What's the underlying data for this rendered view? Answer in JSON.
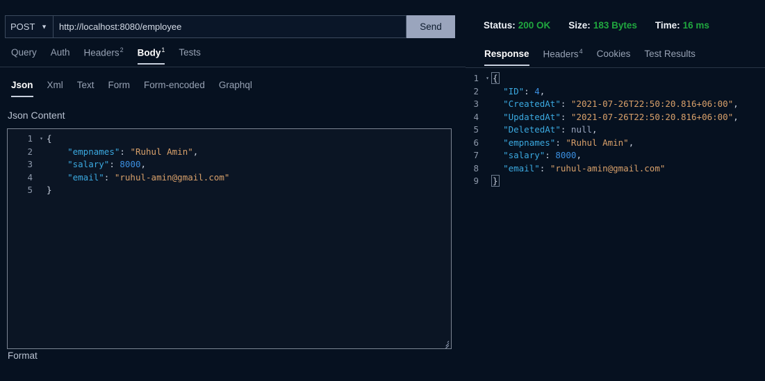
{
  "request": {
    "method": "POST",
    "method_caret_icon": "chevron-down-icon",
    "url": "http://localhost:8080/employee",
    "url_placeholder": "http://localhost:8080/employee",
    "send_label": "Send",
    "tabs": [
      {
        "label": "Query",
        "badge": "",
        "active": false
      },
      {
        "label": "Auth",
        "badge": "",
        "active": false
      },
      {
        "label": "Headers",
        "badge": "2",
        "active": false
      },
      {
        "label": "Body",
        "badge": "1",
        "active": true
      },
      {
        "label": "Tests",
        "badge": "",
        "active": false
      }
    ],
    "body_tabs": [
      {
        "label": "Json",
        "badge": "",
        "active": true
      },
      {
        "label": "Xml",
        "badge": "",
        "active": false
      },
      {
        "label": "Text",
        "badge": "",
        "active": false
      },
      {
        "label": "Form",
        "badge": "",
        "active": false
      },
      {
        "label": "Form-encoded",
        "badge": "",
        "active": false
      },
      {
        "label": "Graphql",
        "badge": "",
        "active": false
      }
    ],
    "content_label": "Json Content",
    "format_label": "Format",
    "editor_lines": [
      {
        "n": "1",
        "fold": "▾",
        "text": "{"
      },
      {
        "n": "2",
        "fold": "",
        "text": "    \"empnames\": \"Ruhul Amin\","
      },
      {
        "n": "3",
        "fold": "",
        "text": "    \"salary\": 8000,"
      },
      {
        "n": "4",
        "fold": "",
        "text": "    \"email\": \"ruhul-amin@gmail.com\""
      },
      {
        "n": "5",
        "fold": "",
        "text": "}"
      }
    ]
  },
  "response": {
    "status": {
      "label": "Status:",
      "value": "200 OK"
    },
    "size": {
      "label": "Size:",
      "value": "183 Bytes"
    },
    "time": {
      "label": "Time:",
      "value": "16 ms"
    },
    "tabs": [
      {
        "label": "Response",
        "badge": "",
        "active": true
      },
      {
        "label": "Headers",
        "badge": "4",
        "active": false
      },
      {
        "label": "Cookies",
        "badge": "",
        "active": false
      },
      {
        "label": "Test Results",
        "badge": "",
        "active": false
      }
    ],
    "body_lines": [
      {
        "n": "1",
        "fold": "▾",
        "text": "{"
      },
      {
        "n": "2",
        "fold": "",
        "text": "  \"ID\": 4,"
      },
      {
        "n": "3",
        "fold": "",
        "text": "  \"CreatedAt\": \"2021-07-26T22:50:20.816+06:00\","
      },
      {
        "n": "4",
        "fold": "",
        "text": "  \"UpdatedAt\": \"2021-07-26T22:50:20.816+06:00\","
      },
      {
        "n": "5",
        "fold": "",
        "text": "  \"DeletedAt\": null,"
      },
      {
        "n": "6",
        "fold": "",
        "text": "  \"empnames\": \"Ruhul Amin\","
      },
      {
        "n": "7",
        "fold": "",
        "text": "  \"salary\": 8000,"
      },
      {
        "n": "8",
        "fold": "",
        "text": "  \"email\": \"ruhul-amin@gmail.com\""
      },
      {
        "n": "9",
        "fold": "",
        "text": "}"
      }
    ]
  },
  "colors": {
    "background": "#061120",
    "panel_border": "#5e6877",
    "accent_green": "#20a83f",
    "send_button_bg": "#9aa5bd",
    "key_blue": "#3ba9e0",
    "string_orange": "#d8a06a",
    "number_blue": "#3b8fe0"
  }
}
